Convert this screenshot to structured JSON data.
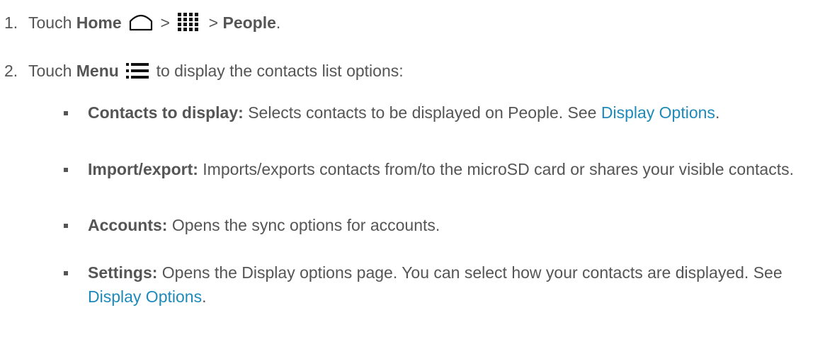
{
  "steps": [
    {
      "number": "1.",
      "pre": "Touch",
      "home_label": "Home",
      "home_icon": "home-outline-icon",
      "sep1": ">",
      "apps_icon": "app-grid-icon",
      "sep2": ">",
      "people_label": "People",
      "end": "."
    },
    {
      "number": "2.",
      "pre": "Touch",
      "menu_label": "Menu",
      "menu_icon": "menu-lines-icon",
      "post": "to display the contacts list options:"
    }
  ],
  "options": [
    {
      "label": "Contacts to display:",
      "text": "Selects contacts to be displayed on People. See",
      "link": "Display Options",
      "after": "."
    },
    {
      "label": "Import/export:",
      "text": "Imports/exports contacts from/to the microSD card or shares your visible contacts.",
      "link": "",
      "after": ""
    },
    {
      "label": "Accounts:",
      "text": "Opens the sync options for accounts.",
      "link": "",
      "after": ""
    },
    {
      "label": "Settings:",
      "text": "Opens the Display options page. You can select how your contacts are displayed. See",
      "link": "Display Options",
      "after": "."
    }
  ],
  "colors": {
    "text": "#555555",
    "link": "#1f8ab9",
    "icon": "#111111"
  }
}
